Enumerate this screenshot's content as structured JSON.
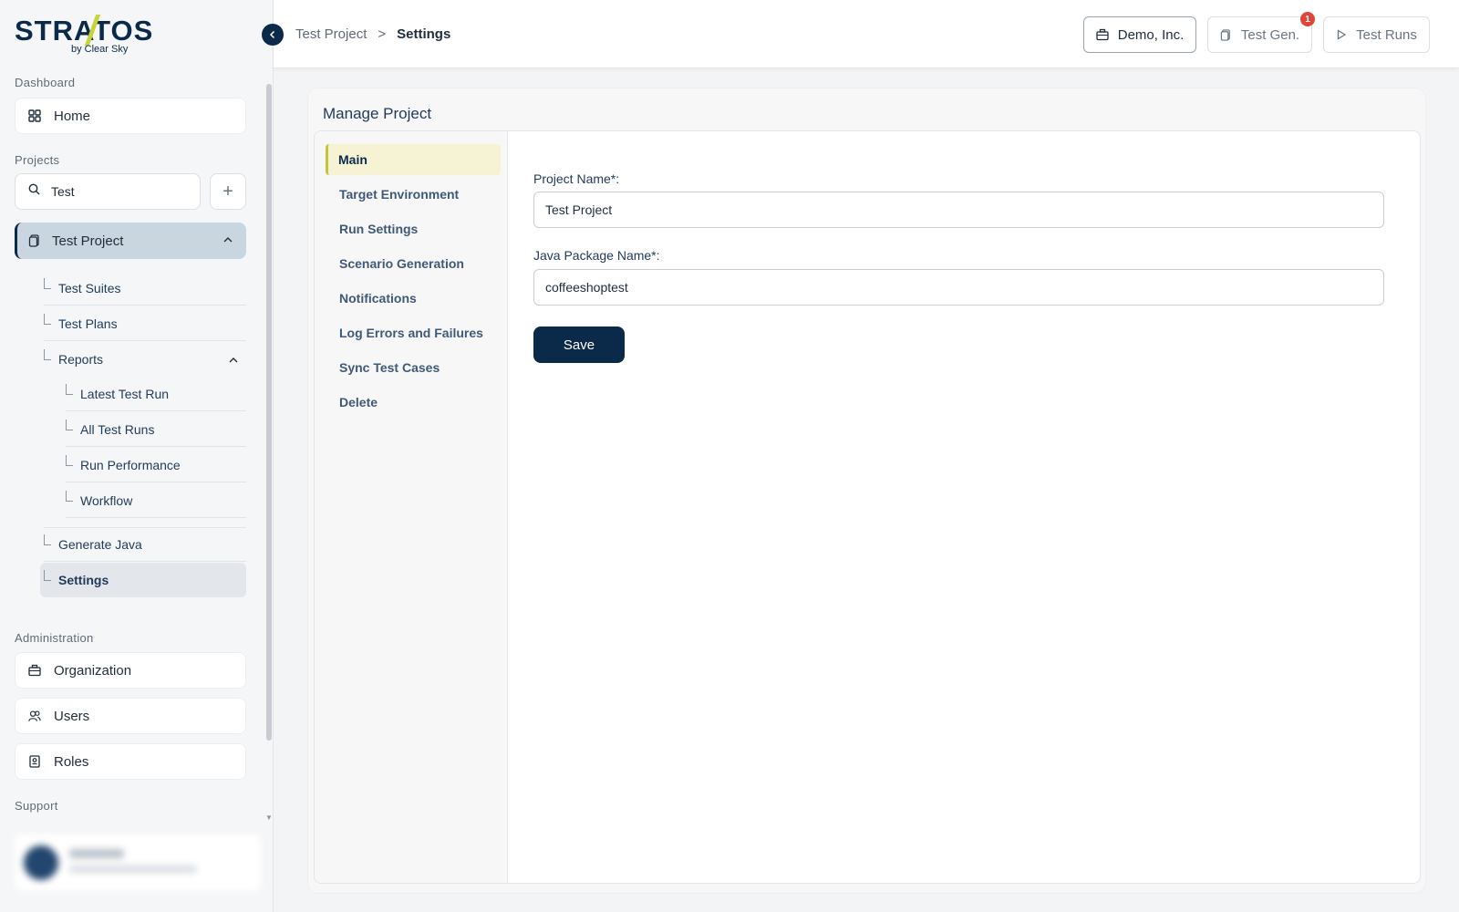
{
  "brand": {
    "logo_text": "STRATOS",
    "logo_sub": "by Clear Sky",
    "accent": "#c6d43a",
    "primary": "#0b2a4a"
  },
  "sidebar": {
    "dashboard_label": "Dashboard",
    "home_label": "Home",
    "projects_label": "Projects",
    "search": {
      "value": "Test",
      "placeholder": ""
    },
    "add_icon": "plus-icon",
    "active_project": "Test Project",
    "tree": {
      "test_suites": "Test Suites",
      "test_plans": "Test Plans",
      "reports": "Reports",
      "latest_test_run": "Latest Test Run",
      "all_test_runs": "All Test Runs",
      "run_performance": "Run Performance",
      "workflow": "Workflow",
      "generate_java": "Generate Java",
      "settings": "Settings"
    },
    "administration_label": "Administration",
    "organization_label": "Organization",
    "users_label": "Users",
    "roles_label": "Roles",
    "support_label": "Support"
  },
  "topbar": {
    "breadcrumb_parent": "Test Project",
    "breadcrumb_sep": ">",
    "breadcrumb_current": "Settings",
    "org_button": "Demo, Inc.",
    "testgen_button": "Test Gen.",
    "testgen_badge": "1",
    "testruns_button": "Test Runs"
  },
  "main": {
    "title": "Manage Project",
    "tabs": [
      "Main",
      "Target Environment",
      "Run Settings",
      "Scenario Generation",
      "Notifications",
      "Log Errors and Failures",
      "Sync Test Cases",
      "Delete"
    ],
    "project_name_label": "Project Name*:",
    "project_name_value": "Test Project",
    "java_package_label": "Java Package Name*:",
    "java_package_value": "coffeeshoptest",
    "save_label": "Save"
  }
}
